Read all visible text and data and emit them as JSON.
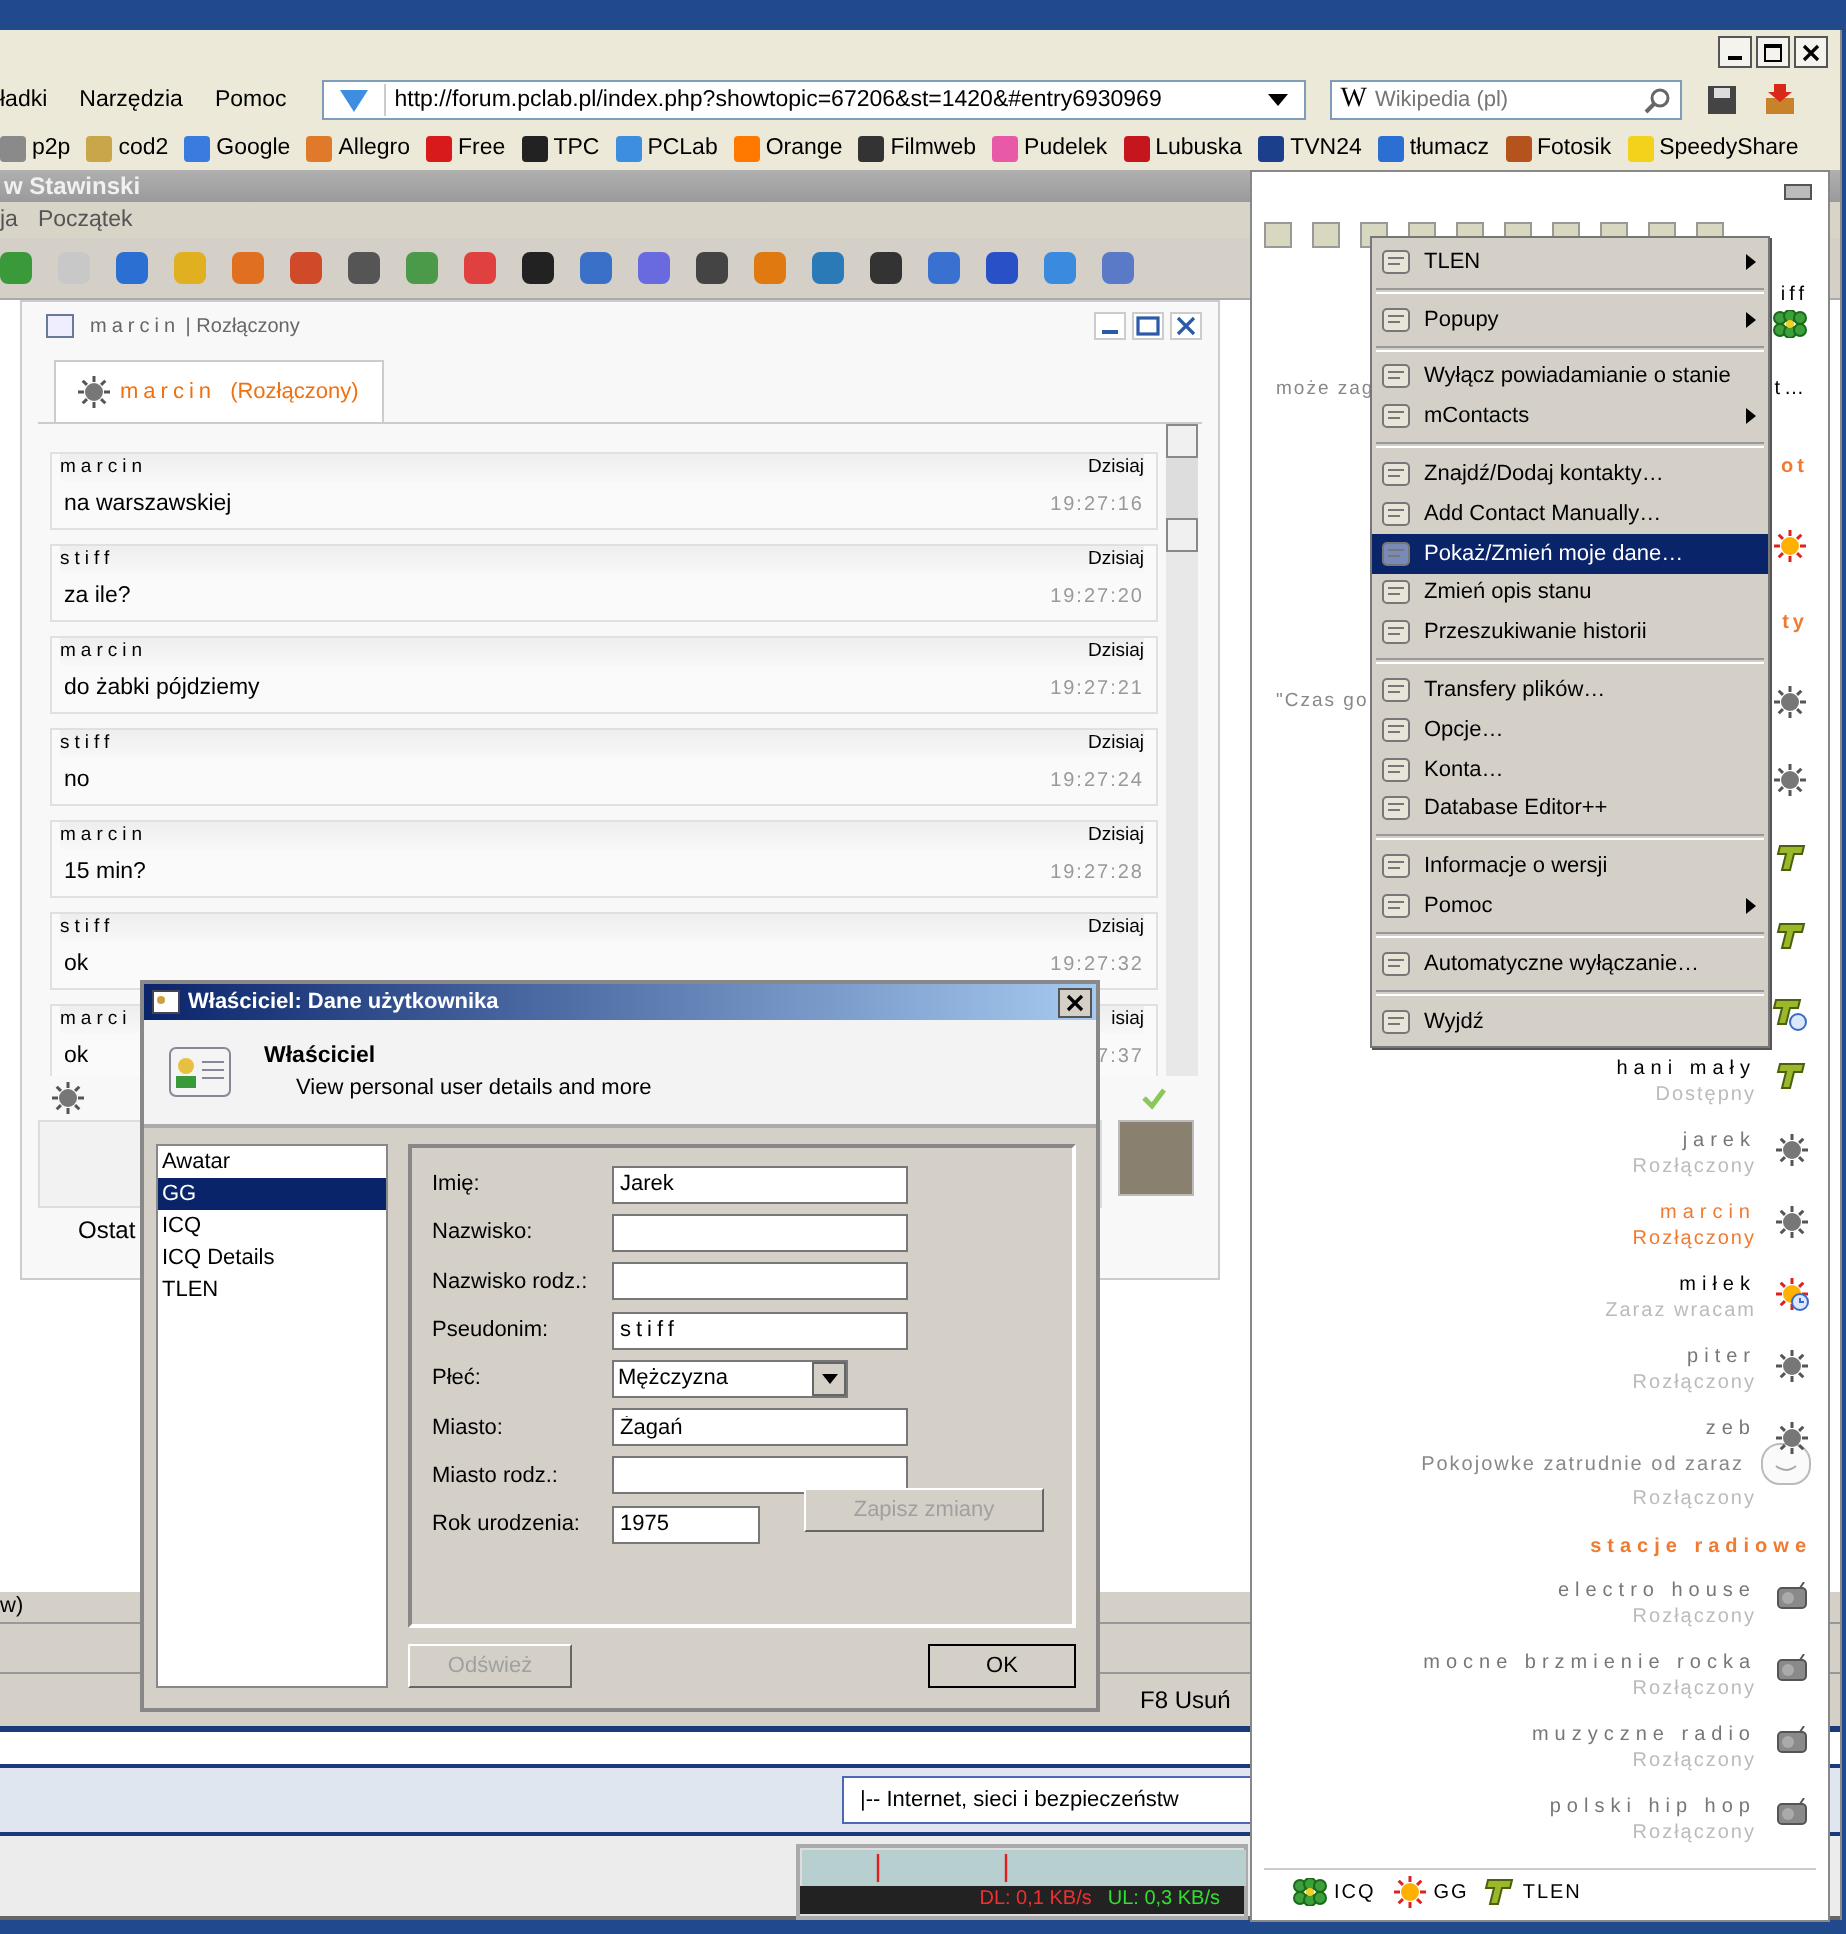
{
  "browser": {
    "menu": [
      "ładki",
      "Narzędzia",
      "Pomoc"
    ],
    "url": "http://forum.pclab.pl/index.php?showtopic=67206&st=1420&#entry6930969",
    "search_engine": "W",
    "search_placeholder": "Wikipedia (pl)",
    "bookmarks": [
      {
        "label": "p2p",
        "color": "#8a8a8a"
      },
      {
        "label": "cod2",
        "color": "#c9a64a"
      },
      {
        "label": "Google",
        "color": "#3a7be0"
      },
      {
        "label": "Allegro",
        "color": "#e07a2a"
      },
      {
        "label": "Free",
        "color": "#d81a1a"
      },
      {
        "label": "TPC",
        "color": "#222222"
      },
      {
        "label": "PCLab",
        "color": "#3d8ee0"
      },
      {
        "label": "Orange",
        "color": "#ff7900"
      },
      {
        "label": "Filmweb",
        "color": "#333333"
      },
      {
        "label": "Pudelek",
        "color": "#e85aa8"
      },
      {
        "label": "Lubuska",
        "color": "#c4161c"
      },
      {
        "label": "TVN24",
        "color": "#1c3f8c"
      },
      {
        "label": "tłumacz",
        "color": "#2a6fd1"
      },
      {
        "label": "Fotosik",
        "color": "#b4531c"
      },
      {
        "label": "SpeedyShare",
        "color": "#f2d21b"
      }
    ]
  },
  "app_window": {
    "title": "w Stawinski",
    "menu": [
      "ja",
      "Początek"
    ]
  },
  "chat": {
    "title_name": "marcin",
    "title_separator": "|",
    "title_status": "Rozłączony",
    "tab": {
      "name": "marcin",
      "status": "(Rozłączony)",
      "selected": true
    },
    "messages": [
      {
        "sender": "marcin",
        "day": "Dzisiaj",
        "text": "na warszawskiej",
        "time": "19:27:16"
      },
      {
        "sender": "stiff",
        "day": "Dzisiaj",
        "text": "za ile?",
        "time": "19:27:20"
      },
      {
        "sender": "marcin",
        "day": "Dzisiaj",
        "text": "do żabki pójdziemy",
        "time": "19:27:21"
      },
      {
        "sender": "stiff",
        "day": "Dzisiaj",
        "text": "no",
        "time": "19:27:24"
      },
      {
        "sender": "marcin",
        "day": "Dzisiaj",
        "text": "15 min?",
        "time": "19:27:28"
      },
      {
        "sender": "stiff",
        "day": "Dzisiaj",
        "text": "ok",
        "time": "19:27:32"
      },
      {
        "sender": "marci",
        "day": "isiaj",
        "text": "ok",
        "time": "7:37"
      }
    ],
    "footer": "Ostat"
  },
  "background": {
    "row_text": "w)",
    "hotkey": "F8 Usuń",
    "forum_select": "|-- Internet, sieci i bezpieczeństw",
    "download": "DL: 0,1 KB/s",
    "upload": "UL: 0,3 KB/s"
  },
  "dialog": {
    "title": "Właściciel: Dane użytkownika",
    "heading": "Właściciel",
    "subheading": "View personal user details and more",
    "pages": [
      {
        "label": "Awatar",
        "selected": false
      },
      {
        "label": "GG",
        "selected": true
      },
      {
        "label": "ICQ",
        "selected": false
      },
      {
        "label": "ICQ Details",
        "selected": false
      },
      {
        "label": "TLEN",
        "selected": false
      }
    ],
    "fields": [
      {
        "kind": "text",
        "label": "Imię:",
        "value": "Jarek"
      },
      {
        "kind": "text",
        "label": "Nazwisko:"
      },
      {
        "kind": "text",
        "label": "Nazwisko rodz.:"
      },
      {
        "kind": "nickname",
        "label": "Pseudonim:",
        "value": "stiff"
      },
      {
        "kind": "select",
        "label": "Płeć:",
        "value": "Mężczyzna"
      },
      {
        "kind": "text",
        "label": "Miasto:",
        "value": "Żagań"
      },
      {
        "kind": "text",
        "label": "Miasto rodz.:"
      },
      {
        "kind": "short",
        "label": "Rok urodzenia:",
        "value": "1975"
      }
    ],
    "save_button": {
      "label": "Zapisz zmiany",
      "disabled": true
    },
    "refresh_button": {
      "label": "Odśwież",
      "disabled": true
    },
    "ok_button": {
      "label": "OK",
      "disabled": false
    }
  },
  "contact_list": {
    "behind_menu": [
      {
        "kind": "icq",
        "right": "iff"
      },
      {
        "kind": "blank",
        "left": "może zag",
        "right": "t…"
      },
      {
        "kind": "group",
        "right": "ot"
      },
      {
        "kind": "gg"
      },
      {
        "kind": "group",
        "right": "ty"
      },
      {
        "kind": "gg_offline",
        "left": "\"Czas go"
      },
      {
        "kind": "gg_offline"
      },
      {
        "kind": "tlen"
      },
      {
        "kind": "tlen"
      },
      {
        "kind": "tlen_away"
      }
    ],
    "entries": [
      {
        "kind": "tlen",
        "name": "hani mały",
        "status": "Dostępny",
        "highlighted": false,
        "online": true
      },
      {
        "kind": "gg_offline",
        "name": "jarek",
        "status": "Rozłączony",
        "highlighted": false,
        "online": false
      },
      {
        "kind": "gg_offline",
        "name": "marcin",
        "status": "Rozłączony",
        "highlighted": true,
        "online": false
      },
      {
        "kind": "gg_away",
        "name": "miłek",
        "status": "Zaraz wracam",
        "highlighted": false,
        "online": true
      },
      {
        "kind": "gg_offline",
        "name": "piter",
        "status": "Rozłączony",
        "highlighted": false,
        "online": false
      },
      {
        "kind": "gg_offline",
        "name": "zeb",
        "mood": "Pokojowke zatrudnie od zaraz",
        "status": "Rozłączony",
        "highlighted": false,
        "online": false
      },
      {
        "kind": "group",
        "name": "stacje radiowe"
      },
      {
        "kind": "radio",
        "name": "electro house",
        "status": "Rozłączony",
        "highlighted": false,
        "online": false
      },
      {
        "kind": "radio",
        "name": "mocne brzmienie rocka",
        "status": "Rozłączony",
        "highlighted": false,
        "online": false
      },
      {
        "kind": "radio",
        "name": "muzyczne radio",
        "status": "Rozłączony",
        "highlighted": false,
        "online": false
      },
      {
        "kind": "radio",
        "name": "polski hip hop",
        "status": "Rozłączony",
        "highlighted": false,
        "online": false
      }
    ],
    "protocols": [
      {
        "kind": "icq",
        "label": "ICQ"
      },
      {
        "kind": "gg",
        "label": "GG"
      },
      {
        "kind": "tlen",
        "label": "TLEN"
      }
    ]
  },
  "menu": [
    {
      "kind": "item",
      "label": "TLEN",
      "submenu": true,
      "selected": false
    },
    {
      "kind": "separator"
    },
    {
      "kind": "item",
      "label": "Popupy",
      "submenu": true,
      "selected": false
    },
    {
      "kind": "separator"
    },
    {
      "kind": "item",
      "label": "Wyłącz powiadamianie o stanie",
      "submenu": false,
      "selected": false
    },
    {
      "kind": "item",
      "label": "mContacts",
      "submenu": true,
      "selected": false
    },
    {
      "kind": "separator"
    },
    {
      "kind": "item",
      "label": "Znajdź/Dodaj kontakty…",
      "submenu": false,
      "selected": false
    },
    {
      "kind": "item",
      "label": "Add Contact Manually…",
      "submenu": false,
      "selected": false
    },
    {
      "kind": "item",
      "label": "Pokaż/Zmień moje dane…",
      "submenu": false,
      "selected": true
    },
    {
      "kind": "item",
      "label": "Zmień opis stanu",
      "submenu": false,
      "selected": false
    },
    {
      "kind": "item",
      "label": "Przeszukiwanie historii",
      "submenu": false,
      "selected": false
    },
    {
      "kind": "separator"
    },
    {
      "kind": "item",
      "label": "Transfery plików…",
      "submenu": false,
      "selected": false
    },
    {
      "kind": "item",
      "label": "Opcje…",
      "submenu": false,
      "selected": false
    },
    {
      "kind": "item",
      "label": "Konta…",
      "submenu": false,
      "selected": false
    },
    {
      "kind": "item",
      "label": "Database Editor++",
      "submenu": false,
      "selected": false
    },
    {
      "kind": "separator"
    },
    {
      "kind": "item",
      "label": "Informacje o wersji",
      "submenu": false,
      "selected": false
    },
    {
      "kind": "item",
      "label": "Pomoc",
      "submenu": true,
      "selected": false
    },
    {
      "kind": "separator"
    },
    {
      "kind": "item",
      "label": "Automatyczne wyłączanie…",
      "submenu": false,
      "selected": false
    },
    {
      "kind": "separator"
    },
    {
      "kind": "item",
      "label": "Wyjdź",
      "submenu": false,
      "selected": false
    }
  ]
}
